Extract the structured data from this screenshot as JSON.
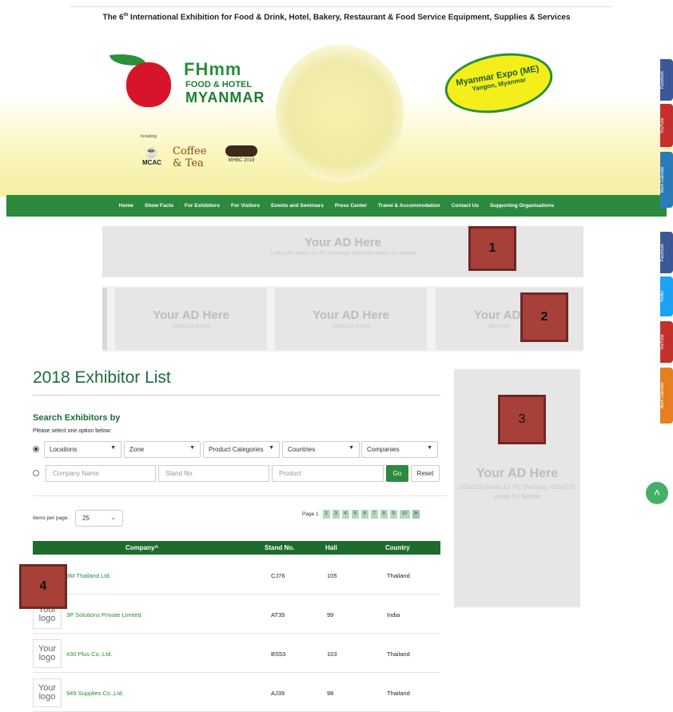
{
  "header": {
    "tagline_pre": "The 6",
    "tagline_sup": "th",
    "tagline_post": " International Exhibition for Food & Drink, Hotel, Bakery, Restaurant & Food Service Equipment, Supplies & Services",
    "logo_title": "FHmm",
    "logo_subtitle": "FOOD & HOTEL",
    "logo_country": "MYANMAR",
    "including": "Including",
    "sublogos": [
      "MCAC",
      "Coffee & Tea",
      "MHBC 2019"
    ],
    "venue_line1": "Myanmar Expo (ME)",
    "venue_line2": "Yangon, Myanmar"
  },
  "nav": {
    "items": [
      "Home",
      "Show Facts",
      "For Exhibitors",
      "For Visitors",
      "Events and Seminars",
      "Press Center",
      "Travel & Accommodation",
      "Contact Us",
      "Supporting Organisations"
    ]
  },
  "ads": {
    "title": "Your AD Here",
    "leaderboard_sub": "1140x150 pixels for PC Desktop, 480x200 pixels for Mobile",
    "small_sub": "360x150 pixels",
    "small_title_cut": "Your AD",
    "small_sub_cut": "360x150",
    "side_sub": "265x500 pixels for PC Desktop, 480x200 pixels for Mobile"
  },
  "labels": [
    "1",
    "2",
    "3",
    "4"
  ],
  "side_buttons": [
    "Facebook",
    "YouTube",
    "Mark Calendar",
    "Facebook",
    "Twitter",
    "YouTube",
    "Mark Calendar"
  ],
  "colors": {
    "brand_green": "#2b8a3e",
    "dark_green": "#1e6b2e",
    "label_red": "#a8403a"
  },
  "page": {
    "title": "2018 Exhibitor List",
    "search_title": "Search Exhibitors by",
    "search_hint": "Please select one option below:",
    "selects": [
      "Locations",
      "Zone",
      "Product Categories",
      "Countries",
      "Companies"
    ],
    "placeholders": {
      "company": "Company Name",
      "stand": "Stand No.",
      "product": "Product"
    },
    "go": "Go",
    "reset": "Reset",
    "items_per_page_label": "Items per page:",
    "items_per_page_value": "25",
    "page_label": "Page 1",
    "pages": [
      "2",
      "3",
      "4",
      "5",
      "6",
      "7",
      "8",
      "9",
      "10"
    ],
    "next": ">"
  },
  "table": {
    "headers": {
      "company": "Company^",
      "stand": "Stand No.",
      "hall": "Hall",
      "country": "Country"
    },
    "logo_placeholder_1": "Your",
    "logo_placeholder_2": "logo",
    "rows": [
      {
        "company": "3M Thailand Ltd.",
        "stand": "CJ76",
        "hall": "105",
        "country": "Thailand"
      },
      {
        "company": "3P Solutions Private Limited",
        "stand": "AT35",
        "hall": "99",
        "country": "India"
      },
      {
        "company": "430 Plus Co.,Ltd.",
        "stand": "BS53",
        "hall": "103",
        "country": "Thailand"
      },
      {
        "company": "949 Supplies Co.,Ltd.",
        "stand": "AJ39",
        "hall": "98",
        "country": "Thailand"
      }
    ]
  }
}
